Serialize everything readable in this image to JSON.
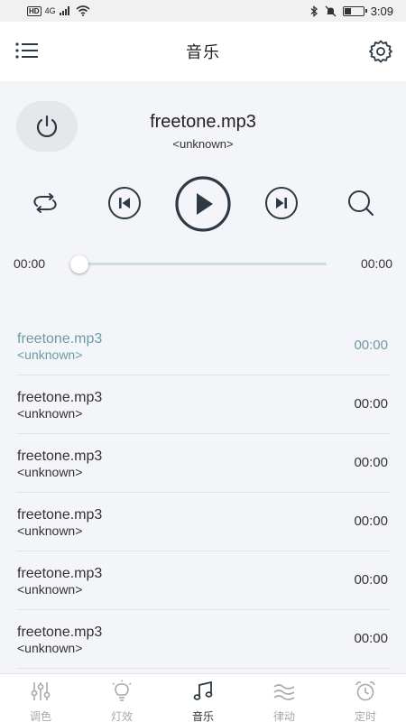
{
  "status": {
    "network_badge": "HD",
    "network_type": "4G",
    "time": "3:09",
    "battery_level": 0.35
  },
  "header": {
    "title": "音乐"
  },
  "now_playing": {
    "title": "freetone.mp3",
    "artist": "<unknown>",
    "elapsed": "00:00",
    "duration": "00:00",
    "progress": 0
  },
  "playlist": [
    {
      "title": "freetone.mp3",
      "artist": "<unknown>",
      "time": "00:00",
      "active": true
    },
    {
      "title": "freetone.mp3",
      "artist": "<unknown>",
      "time": "00:00",
      "active": false
    },
    {
      "title": "freetone.mp3",
      "artist": "<unknown>",
      "time": "00:00",
      "active": false
    },
    {
      "title": "freetone.mp3",
      "artist": "<unknown>",
      "time": "00:00",
      "active": false
    },
    {
      "title": "freetone.mp3",
      "artist": "<unknown>",
      "time": "00:00",
      "active": false
    },
    {
      "title": "freetone.mp3",
      "artist": "<unknown>",
      "time": "00:00",
      "active": false
    }
  ],
  "tabs": [
    {
      "label": "调色",
      "icon": "sliders-icon",
      "active": false
    },
    {
      "label": "灯效",
      "icon": "bulb-icon",
      "active": false
    },
    {
      "label": "音乐",
      "icon": "music-note-icon",
      "active": true
    },
    {
      "label": "律动",
      "icon": "wave-icon",
      "active": false
    },
    {
      "label": "定时",
      "icon": "alarm-clock-icon",
      "active": false
    }
  ],
  "colors": {
    "accent": "#6e9aa5",
    "icon_dark": "#2d3a44",
    "track": "#c9dde3",
    "inactive_tab": "#a8a8a8"
  }
}
